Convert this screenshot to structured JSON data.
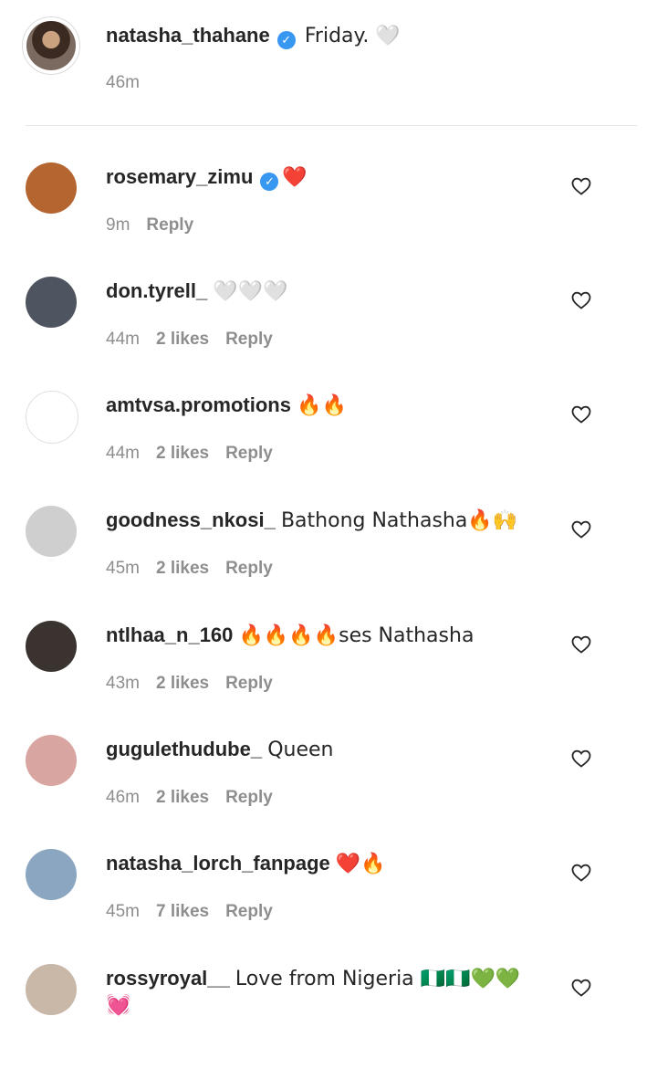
{
  "caption": {
    "username": "natasha_thahane",
    "text": "Friday. 🤍",
    "time": "46m"
  },
  "comments": [
    {
      "username": "rosemary_zimu",
      "verified": true,
      "text": "❤️",
      "time": "9m",
      "likes": "",
      "reply": "Reply",
      "avatar_color": "#b5652f"
    },
    {
      "username": "don.tyrell_",
      "verified": false,
      "text": "🤍🤍🤍",
      "time": "44m",
      "likes": "2 likes",
      "reply": "Reply",
      "avatar_color": "#4f5560"
    },
    {
      "username": "amtvsa.promotions",
      "verified": false,
      "text": "🔥🔥",
      "time": "44m",
      "likes": "2 likes",
      "reply": "Reply",
      "avatar_color": "#ffffff"
    },
    {
      "username": "goodness_nkosi_",
      "verified": false,
      "text": "Bathong Nathasha🔥🙌",
      "time": "45m",
      "likes": "2 likes",
      "reply": "Reply",
      "avatar_color": "#cfcfcf"
    },
    {
      "username": "ntlhaa_n_160",
      "verified": false,
      "text": "🔥🔥🔥🔥ses Nathasha",
      "time": "43m",
      "likes": "2 likes",
      "reply": "Reply",
      "avatar_color": "#3b3330"
    },
    {
      "username": "gugulethudube_",
      "verified": false,
      "text": "Queen",
      "time": "46m",
      "likes": "2 likes",
      "reply": "Reply",
      "avatar_color": "#d9a5a0"
    },
    {
      "username": "natasha_lorch_fanpage",
      "verified": false,
      "text": "❤️🔥",
      "time": "45m",
      "likes": "7 likes",
      "reply": "Reply",
      "avatar_color": "#8aa6c0"
    },
    {
      "username": "rossyroyal__",
      "verified": false,
      "text": "Love from Nigeria 🇳🇬🇳🇬💚💚",
      "text2": "💓",
      "time": "",
      "likes": "",
      "reply": "",
      "avatar_color": "#c9b7a8"
    }
  ],
  "icons": {
    "like": "heart-outline-icon",
    "verified": "verified-badge-icon"
  },
  "colors": {
    "verified": "#3897f0",
    "meta": "#8e8e8e"
  }
}
